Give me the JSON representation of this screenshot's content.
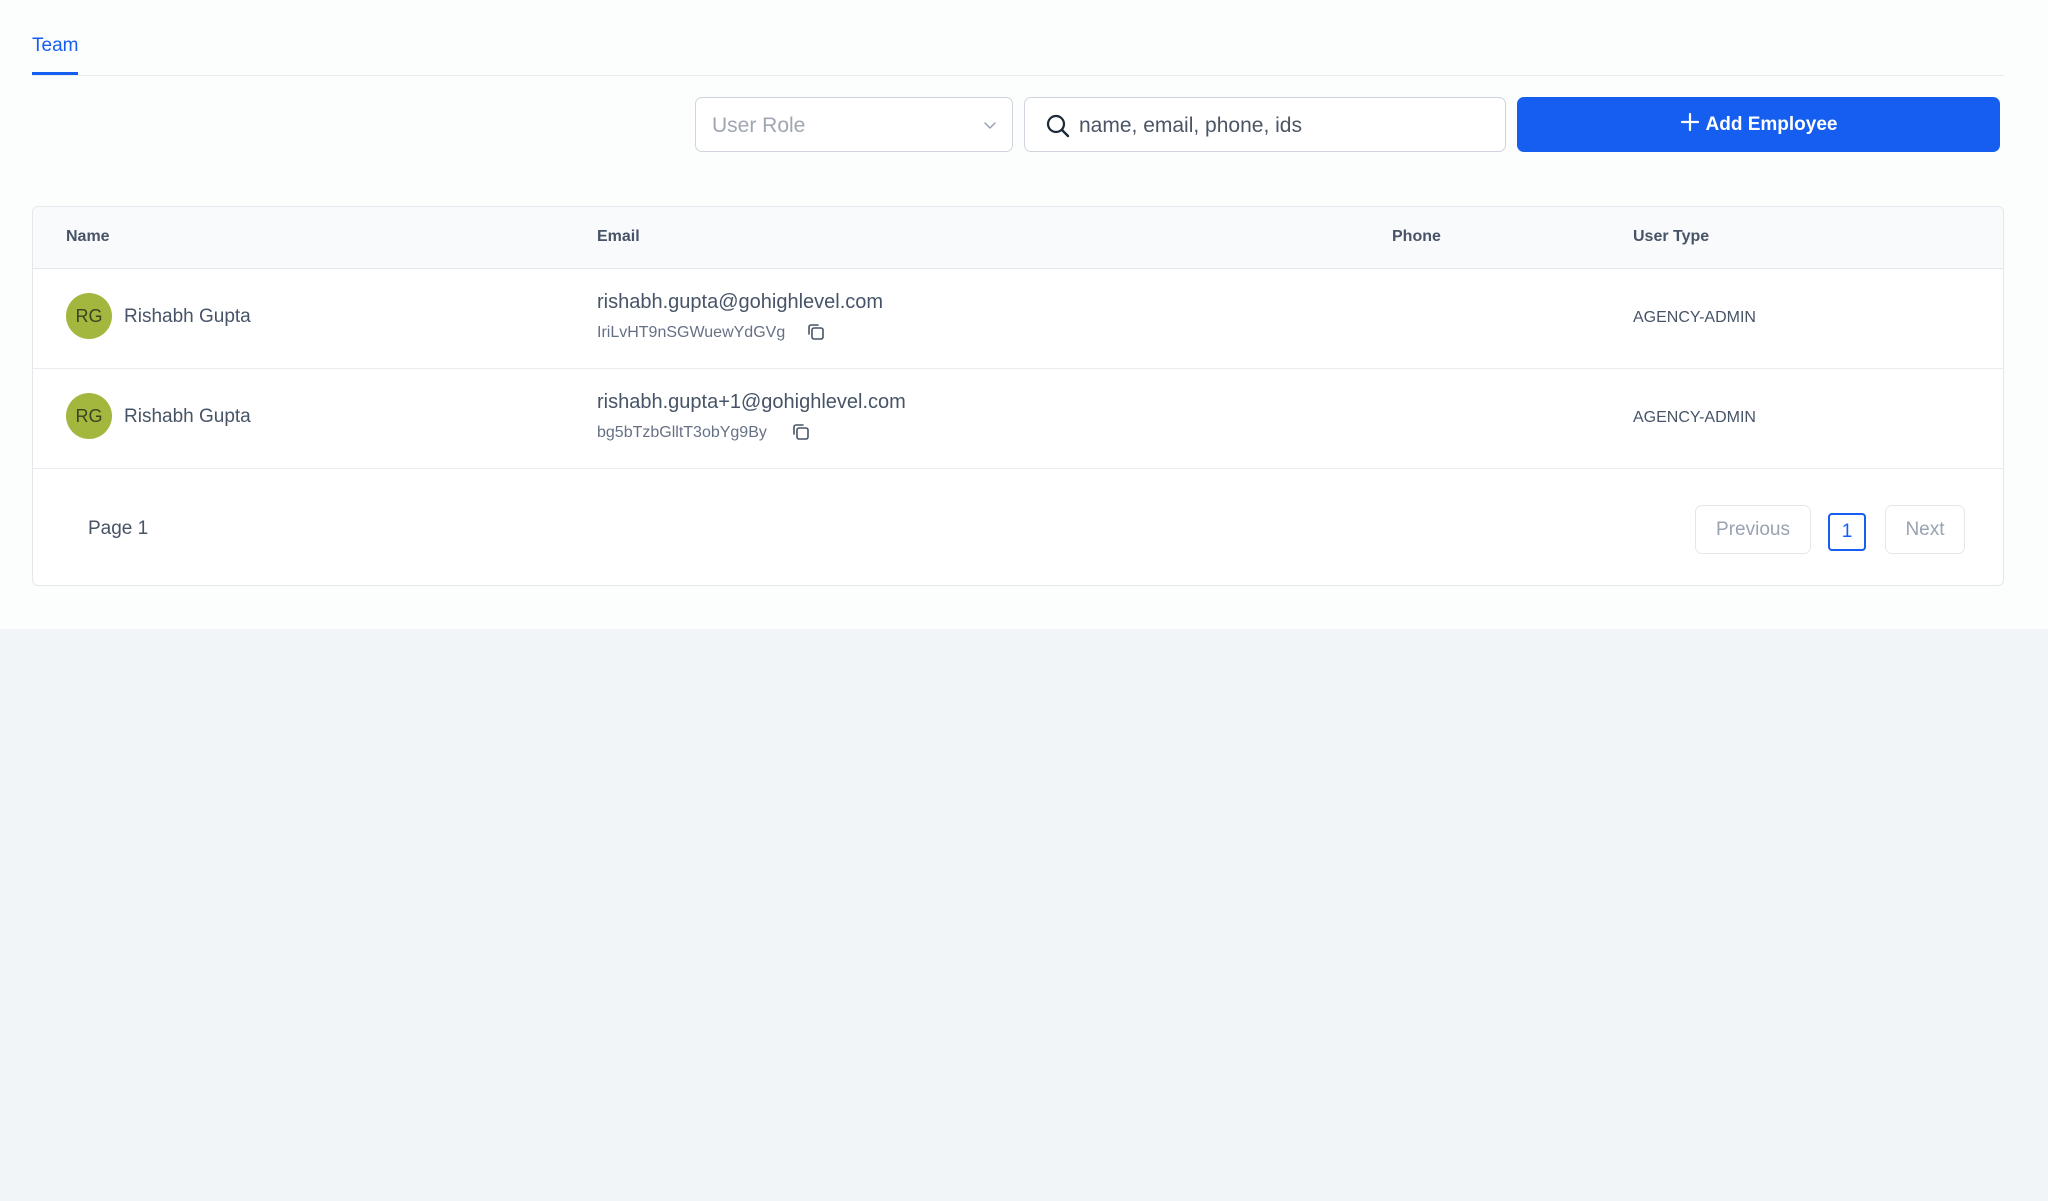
{
  "tabs": [
    {
      "label": "Team",
      "active": true
    }
  ],
  "filters": {
    "role_select": {
      "placeholder": "User Role",
      "value": ""
    },
    "search": {
      "placeholder": "name, email, phone, ids",
      "value": ""
    },
    "add_button_label": "Add Employee"
  },
  "table": {
    "columns": [
      "Name",
      "Email",
      "Phone",
      "User Type"
    ],
    "rows": [
      {
        "initials": "RG",
        "name": "Rishabh Gupta",
        "email": "rishabh.gupta@gohighlevel.com",
        "user_id": "IriLvHT9nSGWuewYdGVg",
        "phone": "",
        "user_type": "AGENCY-ADMIN"
      },
      {
        "initials": "RG",
        "name": "Rishabh Gupta",
        "email": "rishabh.gupta+1@gohighlevel.com",
        "user_id": "bg5bTzbGlltT3obYg9By",
        "phone": "",
        "user_type": "AGENCY-ADMIN"
      }
    ]
  },
  "pagination": {
    "page_label": "Page 1",
    "previous_label": "Previous",
    "next_label": "Next",
    "current_page": "1"
  },
  "colors": {
    "accent": "#155eef",
    "avatar": "#a3b73f",
    "page_background": "#f2f5f8"
  },
  "icons": {
    "select": "chevron-down-icon",
    "search": "search-icon",
    "add": "plus-icon",
    "copy": "copy-icon"
  }
}
